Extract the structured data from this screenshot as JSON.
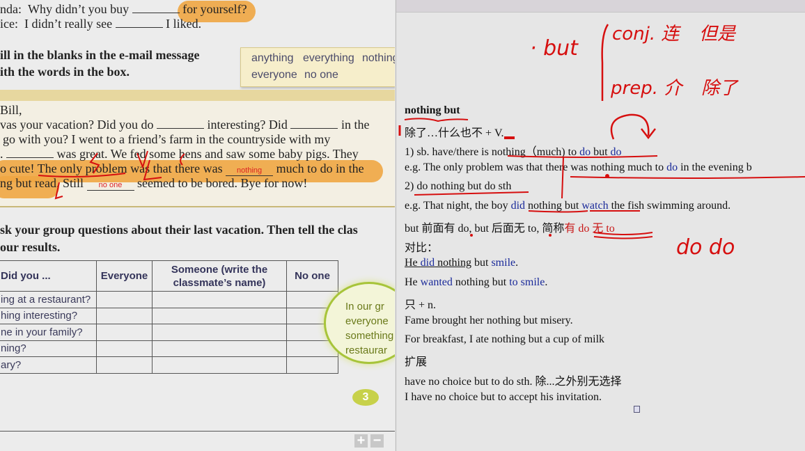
{
  "textbook": {
    "dialogue": [
      {
        "speaker": "nda:",
        "before": "Why didn’t you buy",
        "after": "for yourself?"
      },
      {
        "speaker": "ice:",
        "before": "I didn’t really see",
        "after": "I liked."
      }
    ],
    "instruction_b": [
      "ill in the blanks in the e-mail message",
      "ith the words in the box."
    ],
    "word_box": [
      "anything",
      "everything",
      "nothing",
      "everyone",
      "no one"
    ],
    "email": {
      "greeting": "Bill,",
      "line1": {
        "a": "vas your vacation? Did you do",
        "b": "interesting? Did",
        "c": "in the"
      },
      "line2": "go with you? I went to a friend’s farm in the countryside with my",
      "line3": {
        "a": ".",
        "b": "was great. We fed some hens and saw some baby pigs. They"
      },
      "line4": {
        "a": "o cute! The only problem was that there was",
        "answer": "nothing",
        "b": "much to do in the"
      },
      "line5": {
        "a": "ng but read. Still",
        "answer": "no one",
        "b": "seemed to be bored. Bye for now!"
      }
    },
    "instruction_c": [
      "sk your group questions about their last vacation. Then tell the clas",
      "our results."
    ],
    "table": {
      "headers": [
        "Did you ...",
        "Everyone",
        "Someone (write the classmate’s name)",
        "No one"
      ],
      "rows": [
        "ing at a restaurant?",
        "hing interesting?",
        "ne in your family?",
        "ning?",
        "ary?"
      ]
    },
    "bubble": [
      "In our gr",
      "everyone",
      "something",
      "restaurar"
    ],
    "page_number": "3",
    "zoom_in": "+",
    "zoom_out": "−"
  },
  "notes": {
    "handwriting": {
      "but": "· but",
      "conj": "conj. 连",
      "conj_meaning": "但是",
      "prep": "prep. 介",
      "prep_meaning": "除了",
      "dodo": "do  do"
    },
    "title": "nothing but",
    "meaning": "除了…什么也不  + V.",
    "rule1": {
      "a": "1)  sb. have/there is ",
      "b": "nothing（much) to ",
      "c": "do",
      "d": " but ",
      "e": "do"
    },
    "eg1": {
      "a": "e.g. The only problem was that there was nothing much to ",
      "b": "do",
      "c": " in the evening b"
    },
    "rule2": "2) do nothing but do sth",
    "eg2": {
      "a": "e.g. That night, the boy ",
      "b": "did",
      "c": " nothing but ",
      "d": "watch",
      "e": " the fish swimming around."
    },
    "tip": {
      "a": "but 前面有 do, but 后面无 to,  简称",
      "b": "有 do 无 to"
    },
    "compare": "对比：",
    "cmp1": {
      "a": "He ",
      "b": "did",
      "c": " nothing",
      "d": " but ",
      "e": "smile",
      "f": "."
    },
    "cmp2": {
      "a": "He ",
      "b": "wanted",
      "c": " nothing but ",
      "d": "to smile",
      "e": "."
    },
    "only": "只  + n.",
    "ex1": "Fame brought her nothing but misery.",
    "ex2": "For breakfast, I ate nothing but a cup of milk",
    "extend": "扩展",
    "ext1": "have no choice but to do sth.  除...之外别无选择",
    "ext2": "I have no choice but to accept his invitation."
  },
  "colors": {
    "highlight": "#f0a643",
    "ink": "#d60f0f",
    "blue_text": "#1a2a9a",
    "bubble_green": "#a7c43a"
  }
}
